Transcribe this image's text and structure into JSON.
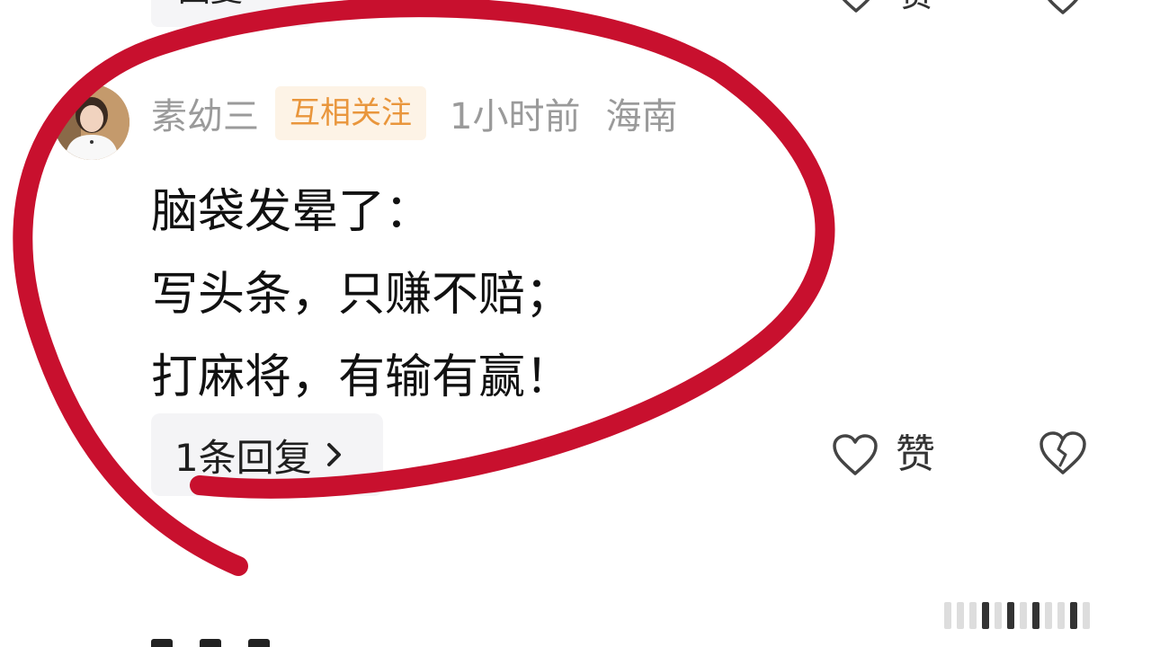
{
  "previous_comment": {
    "reply_label": "回复 ›",
    "like_label": "赞"
  },
  "comment": {
    "username": "素幼三",
    "badge": "互相关注",
    "time": "1小时前",
    "location": "海南",
    "lines": [
      "脑袋发晕了：",
      "写头条，只赚不赔；",
      "打麻将，有输有赢！"
    ],
    "reply_label": "1条回复",
    "like_label": "赞"
  },
  "colors": {
    "meta_text": "#9a9a9a",
    "badge_bg": "#fdf3e6",
    "badge_text": "#e9963c",
    "annotation": "#c8102e"
  },
  "icons": {
    "like": "heart-outline-icon",
    "dislike": "broken-heart-icon",
    "reply_chevron": "chevron-right-icon"
  }
}
